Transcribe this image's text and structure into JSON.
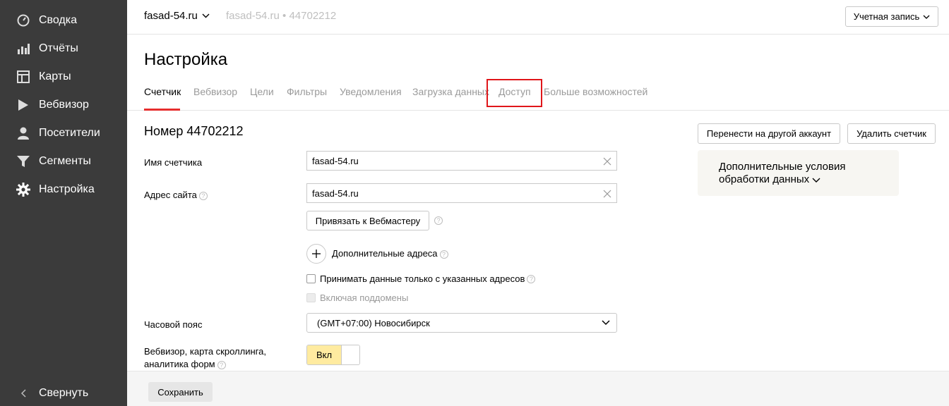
{
  "sidebar": {
    "items": [
      {
        "label": "Сводка",
        "icon": "gauge-icon"
      },
      {
        "label": "Отчёты",
        "icon": "bar-chart-icon"
      },
      {
        "label": "Карты",
        "icon": "layout-map-icon"
      },
      {
        "label": "Вебвизор",
        "icon": "play-icon"
      },
      {
        "label": "Посетители",
        "icon": "person-icon"
      },
      {
        "label": "Сегменты",
        "icon": "filter-icon"
      },
      {
        "label": "Настройка",
        "icon": "gear-icon"
      }
    ],
    "collapse_label": "Свернуть"
  },
  "topbar": {
    "site": "fasad-54.ru",
    "crumb": "fasad-54.ru • 44702212",
    "account_label": "Учетная запись"
  },
  "page": {
    "title": "Настройка",
    "tabs": [
      "Счетчик",
      "Вебвизор",
      "Цели",
      "Фильтры",
      "Уведомления",
      "Загрузка данных",
      "Доступ",
      "Больше возможностей"
    ],
    "active_tab": "Счетчик"
  },
  "form": {
    "number_heading": "Номер 44702212",
    "counter_name_label": "Имя счетчика",
    "counter_name_value": "fasad-54.ru",
    "site_address_label": "Адрес сайта",
    "site_address_value": "fasad-54.ru",
    "webmaster_button": "Привязать к Вебмастеру",
    "additional_addresses": "Дополнительные адреса",
    "only_specified_label": "Принимать данные только с указанных адресов",
    "subdomains_label": "Включая поддомены",
    "timezone_label": "Часовой пояс",
    "timezone_value": "(GMT+07:00) Новосибирск",
    "webvisor_label_line1": "Вебвизор, карта скроллинга,",
    "webvisor_label_line2": "аналитика форм",
    "toggle_on_label": "Вкл"
  },
  "actions": {
    "transfer_button": "Перенести на другой аккаунт",
    "delete_button": "Удалить счетчик",
    "extra_conditions_line1": "Дополнительные условия",
    "extra_conditions_line2": "обработки данных"
  },
  "footer": {
    "save_label": "Сохранить"
  },
  "colors": {
    "sidebar_bg": "#3b3b3b",
    "active_tab_underline": "#e62e2e",
    "highlight_box": "#e0161a",
    "toggle_on": "#ffeba0"
  }
}
